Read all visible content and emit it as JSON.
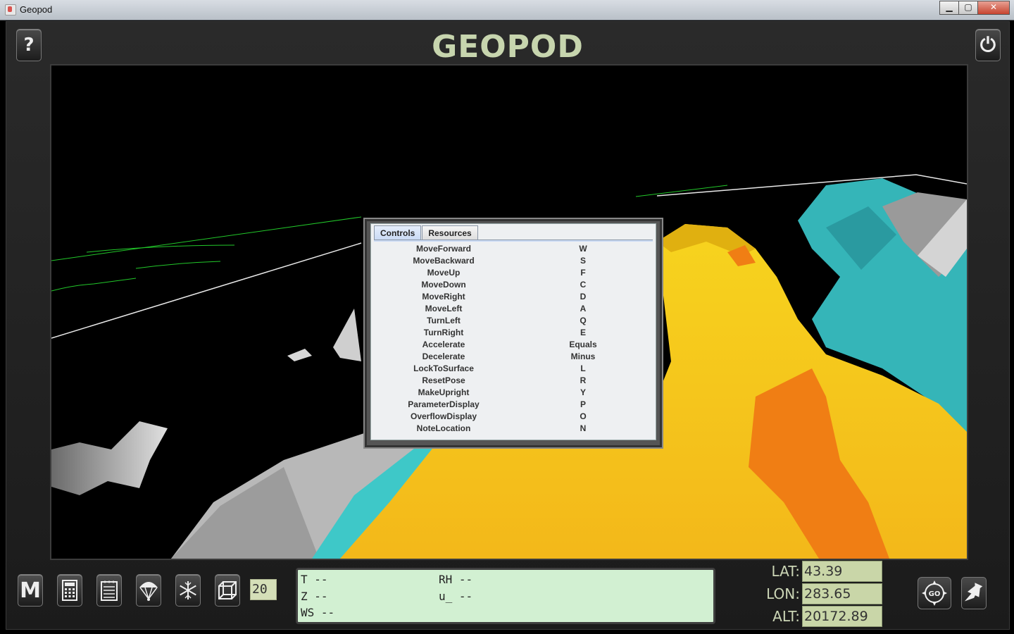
{
  "window": {
    "title": "Geopod",
    "min": "▁",
    "max": "▢",
    "close": "✕"
  },
  "app": {
    "logo": "GEOPOD",
    "help_icon": "?",
    "power_icon": "⏻"
  },
  "dialog": {
    "tabs": [
      {
        "label": "Controls",
        "active": true
      },
      {
        "label": "Resources",
        "active": false
      }
    ],
    "controls": [
      {
        "action": "MoveForward",
        "key": "W"
      },
      {
        "action": "MoveBackward",
        "key": "S"
      },
      {
        "action": "MoveUp",
        "key": "F"
      },
      {
        "action": "MoveDown",
        "key": "C"
      },
      {
        "action": "MoveRight",
        "key": "D"
      },
      {
        "action": "MoveLeft",
        "key": "A"
      },
      {
        "action": "TurnLeft",
        "key": "Q"
      },
      {
        "action": "TurnRight",
        "key": "E"
      },
      {
        "action": "Accelerate",
        "key": "Equals"
      },
      {
        "action": "Decelerate",
        "key": "Minus"
      },
      {
        "action": "LockToSurface",
        "key": "L"
      },
      {
        "action": "ResetPose",
        "key": "R"
      },
      {
        "action": "MakeUpright",
        "key": "Y"
      },
      {
        "action": "ParameterDisplay",
        "key": "P"
      },
      {
        "action": "OverflowDisplay",
        "key": "O"
      },
      {
        "action": "NoteLocation",
        "key": "N"
      }
    ]
  },
  "toolbar": {
    "menu_icon": "M",
    "speed": "20"
  },
  "readout": {
    "t": "T --",
    "rh": "RH --",
    "z": "Z --",
    "u": "u_ --",
    "ws": "WS --"
  },
  "coords": {
    "lat_label": "LAT:",
    "lat": "43.39",
    "lon_label": "LON:",
    "lon": "283.65",
    "alt_label": "ALT:",
    "alt": "20172.89"
  },
  "go_label": "GO",
  "colors": {
    "yellow": "#f7c81c",
    "cyan": "#3cbcc0",
    "orange": "#f07e14",
    "gray": "#a8a8a8"
  }
}
